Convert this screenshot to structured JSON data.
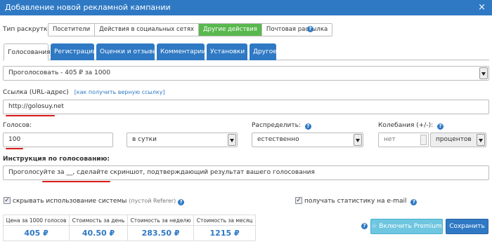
{
  "dialog": {
    "title": "Добавление новой рекламной кампании",
    "close": "×"
  },
  "promo_type": {
    "label": "Тип раскрутки:",
    "options": [
      "Посетители",
      "Действия в социальных сетях",
      "Другие действия",
      "Почтовая рассылка"
    ],
    "selected": "Другие действия",
    "help": "?"
  },
  "tabs": [
    {
      "label": "Голосования",
      "active": true
    },
    {
      "label": "Регистрации"
    },
    {
      "label": "Оценки и отзывы"
    },
    {
      "label": "Комментарии"
    },
    {
      "label": "Установки"
    },
    {
      "label": "Другое"
    }
  ],
  "service_select": {
    "value": "Проголосовать - 405 ₽ за 1000"
  },
  "url": {
    "label": "Ссылка (URL-адрес)",
    "help_link": "[как получить верную ссылку]",
    "value": "http://golosuy.net"
  },
  "votes": {
    "label": "Голосов:",
    "value": "100",
    "period": "в сутки"
  },
  "distribute": {
    "label": "Распределить:",
    "value": "естественно",
    "help": "?"
  },
  "fluctuation": {
    "label": "Колебания (+/-):",
    "placeholder": "нет",
    "unit": "процентов",
    "help": "?"
  },
  "instruction": {
    "label": "Инструкция по голосованию:",
    "value": "Проголосуйте за __, сделайте скриншот, подтверждающий результат вашего голосования"
  },
  "hide_system": {
    "label": "скрывать использование системы",
    "note": "(пустой Referer)",
    "checked": "✓",
    "help": "?"
  },
  "email_stats": {
    "label": "получать статистику на e-mail",
    "checked": "✓",
    "help": "?"
  },
  "prices": {
    "headers": [
      "Цена за 1000 голосов",
      "Стоимость за день",
      "Стоимость за неделю",
      "Стоимость за месяц"
    ],
    "values": [
      "405 ₽",
      "40.50 ₽",
      "283.50 ₽",
      "1215 ₽"
    ]
  },
  "buttons": {
    "premium_help": "?",
    "premium": "☆ Включить Premium",
    "save": "Сохранить"
  },
  "colors": {
    "header": "#2f79c4",
    "active_green": "#58b84d",
    "premium": "#6ec6e0",
    "save": "#2f79c4",
    "underline": "#d81b1b"
  }
}
